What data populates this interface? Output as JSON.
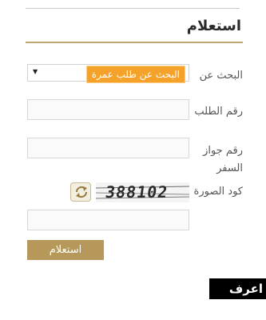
{
  "form": {
    "title": "استعلام",
    "search_by_label": "البحث عن",
    "search_by_value": "البحث عن طلب عمرة",
    "request_number_label": "رقم الطلب",
    "passport_number_label": "رقم جواز السفر",
    "captcha_label": "كود الصورة",
    "captcha_text": "388102",
    "submit_label": "استعلام"
  },
  "watermark": "اعرف كورة",
  "colors": {
    "accent": "#b5985a",
    "highlight": "#f5a22a"
  },
  "icons": {
    "select_arrow": "triangle-down-icon",
    "refresh": "refresh-icon"
  }
}
